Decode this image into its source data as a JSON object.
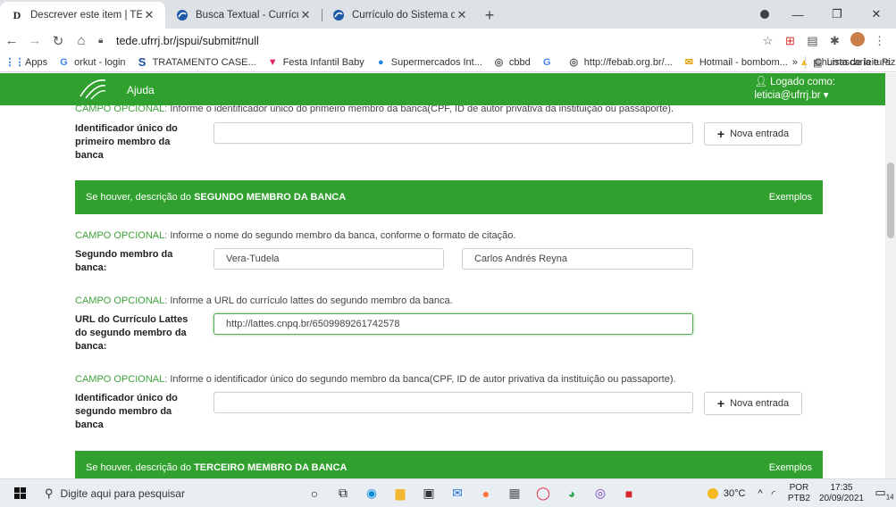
{
  "browser": {
    "tabs": [
      {
        "title": "Descrever este item | TEDE",
        "favicon": "D",
        "active": true
      },
      {
        "title": "Busca Textual - Currículo Lattes",
        "favicon": "lattes-icon",
        "active": false
      },
      {
        "title": "Currículo do Sistema de Currícul",
        "favicon": "lattes-icon",
        "active": false
      }
    ],
    "url": "tede.ufrrj.br/jspui/submit#null",
    "bookmarks": [
      {
        "label": "Apps",
        "icon": "apps-icon"
      },
      {
        "label": "orkut - login",
        "icon": "google-icon"
      },
      {
        "label": "TRATAMENTO CASE...",
        "icon": "s-icon"
      },
      {
        "label": "Festa Infantil Baby",
        "icon": "v-icon"
      },
      {
        "label": "Supermercados Int...",
        "icon": "globe-icon"
      },
      {
        "label": "cbbd",
        "icon": "globe-icon"
      },
      {
        "label": "",
        "icon": "google-icon"
      },
      {
        "label": "http://febab.org.br/...",
        "icon": "globe-icon"
      },
      {
        "label": "Hotmail - bombom...",
        "icon": "mail-icon"
      },
      {
        "label": "Churrascaria e Pizza...",
        "icon": "drive-icon"
      }
    ],
    "bookmarks_more": "»",
    "reading_list": "Lista de leitura"
  },
  "site": {
    "help": "Ajuda",
    "logged_as": "Logado como:",
    "user": "leticia@ufrrj.br ▾",
    "brand_color": "#30a02e"
  },
  "form": {
    "hint1_opt": "CAMPO OPCIONAL:",
    "hint1_text": " Informe o identificador único do primeiro membro da banca(CPF, ID de autor privativa da instituição ou passaporte).",
    "label_first_id": "Identificador único do primeiro membro da banca",
    "new_entry_1": "Nova entrada",
    "section2_prefix": "Se houver, descrição do ",
    "section2_strong": "SEGUNDO MEMBRO DA BANCA",
    "section2_examples": "Exemplos",
    "hint2_opt": "CAMPO OPCIONAL:",
    "hint2_text": " Informe o nome do segundo membro da banca, conforme o formato de citação.",
    "label_second_name": "Segundo membro da banca:",
    "second_last_name": "Vera-Tudela",
    "second_first_name": "Carlos Andrés Reyna",
    "hint3_opt": "CAMPO OPCIONAL:",
    "hint3_text": " Informe a URL do currículo lattes do segundo membro da banca.",
    "label_second_url": "URL do Currículo Lattes do segundo membro da banca:",
    "second_url": "http://lattes.cnpq.br/6509989261742578",
    "hint4_opt": "CAMPO OPCIONAL:",
    "hint4_text": " Informe o identificador único do segundo membro da banca(CPF, ID de autor privativa da instituição ou passaporte).",
    "label_second_id": "Identificador único do segundo membro da banca",
    "new_entry_2": "Nova entrada",
    "section3_prefix": "Se houver, descrição do ",
    "section3_strong": "TERCEIRO MEMBRO DA BANCA",
    "section3_examples": "Exemplos"
  },
  "taskbar": {
    "search_placeholder": "Digite aqui para pesquisar",
    "weather": "30°C",
    "lang_1": "POR",
    "lang_2": "PTB2",
    "time": "17:35",
    "date": "20/09/2021",
    "notifications": "14"
  }
}
